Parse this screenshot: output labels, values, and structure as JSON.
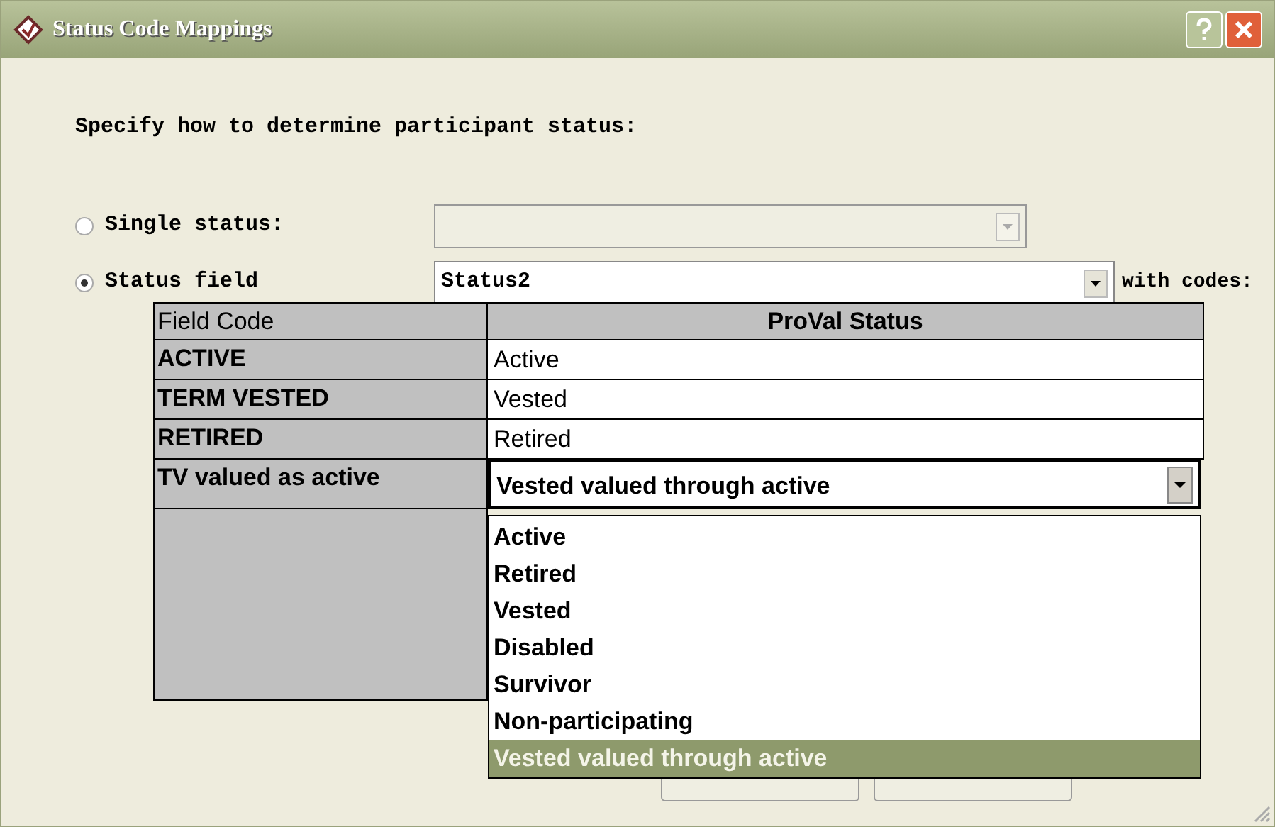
{
  "window": {
    "title": "Status Code Mappings"
  },
  "prompt": "Specify how to determine participant status:",
  "options": [
    {
      "label": "Single status:",
      "selected": false,
      "disabled": true
    },
    {
      "label": "Status field",
      "selected": true,
      "value": "Status2",
      "disabled": false,
      "trailing": "with codes:"
    }
  ],
  "table": {
    "columns": [
      "Field Code",
      "ProVal Status"
    ],
    "rows": [
      {
        "code": "ACTIVE",
        "status": "Active",
        "kind": "text"
      },
      {
        "code": "TERM VESTED",
        "status": "Vested",
        "kind": "text"
      },
      {
        "code": "RETIRED",
        "status": "Retired",
        "kind": "text"
      },
      {
        "code": "TV valued as active",
        "status": "Vested valued through active",
        "kind": "dropdown"
      }
    ]
  },
  "dropdown_list": [
    {
      "label": "Active",
      "selected": false
    },
    {
      "label": "Retired",
      "selected": false
    },
    {
      "label": "Vested",
      "selected": false
    },
    {
      "label": "Disabled",
      "selected": false
    },
    {
      "label": "Survivor",
      "selected": false
    },
    {
      "label": "Non-participating",
      "selected": false
    },
    {
      "label": "Vested valued through active",
      "selected": true
    }
  ]
}
